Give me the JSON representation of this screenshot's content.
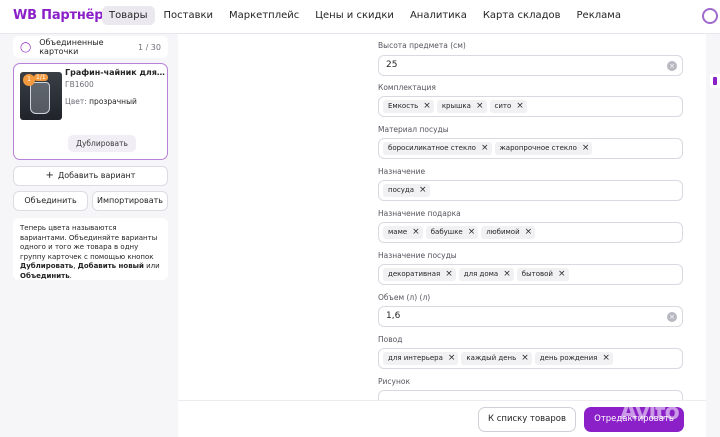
{
  "header": {
    "logo": "WB Партнёры",
    "nav": [
      "Товары",
      "Поставки",
      "Маркетплейс",
      "Цены и скидки",
      "Аналитика",
      "Карта складов",
      "Реклама"
    ]
  },
  "sidebar": {
    "merged_label": "Объединенные карточки",
    "merged_count": "1 / 30",
    "product": {
      "title": "Графин-чайник для воды и ...",
      "code": "ГВ1600",
      "color_label": "Цвет:",
      "color_value": "прозрачный",
      "duplicate_label": "Дублировать",
      "thumb_badge": "1",
      "thumb_badge2": "1/1"
    },
    "add_variant_label": "Добавить вариант",
    "merge_label": "Объединить",
    "import_label": "Импортировать",
    "hint": {
      "text1": "Теперь цвета называются вариантами. Объединяйте варианты одного и того же товара в одну группу карточек с помощью кнопок ",
      "b1": "Дублировать",
      "sep1": ", ",
      "b2": "Добавить новый",
      "sep2": " или ",
      "b3": "Объединить",
      "end": "."
    }
  },
  "form": {
    "height": {
      "label": "Высота предмета (см)",
      "value": "25"
    },
    "kit": {
      "label": "Комплектация",
      "chips": [
        "Емкость",
        "крышка",
        "сито"
      ]
    },
    "material": {
      "label": "Материал посуды",
      "chips": [
        "боросиликатное стекло",
        "жаропрочное стекло"
      ]
    },
    "purpose": {
      "label": "Назначение",
      "chips": [
        "посуда"
      ]
    },
    "gift": {
      "label": "Назначение подарка",
      "chips": [
        "маме",
        "бабушке",
        "любимой"
      ]
    },
    "dish_purpose": {
      "label": "Назначение посуды",
      "chips": [
        "декоративная",
        "для дома",
        "бытовой"
      ]
    },
    "volume": {
      "label": "Объем (л) (л)",
      "value": "1,6"
    },
    "occasion": {
      "label": "Повод",
      "chips": [
        "для интерьера",
        "каждый день",
        "день рождения"
      ]
    },
    "pattern": {
      "label": "Рисунок"
    }
  },
  "footer": {
    "back_label": "К списку товаров",
    "send_label": "Отредактировать"
  },
  "watermark": "Avito",
  "colors": {
    "accent": "#8b20c9"
  }
}
